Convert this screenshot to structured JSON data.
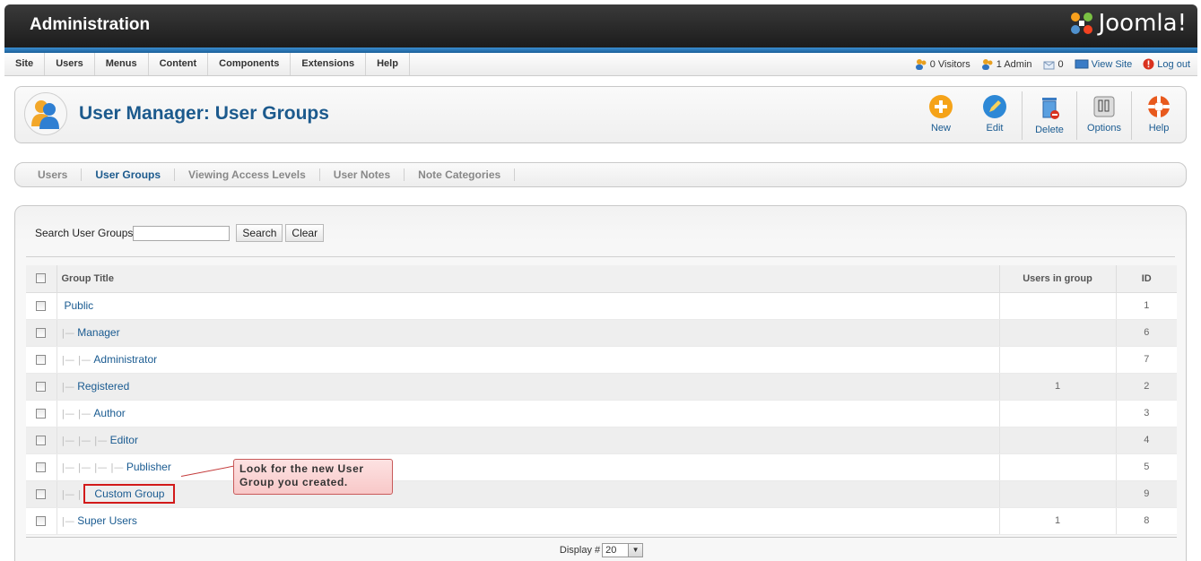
{
  "header": {
    "title": "Administration",
    "logo_text": "Joomla!"
  },
  "menu": [
    "Site",
    "Users",
    "Menus",
    "Content",
    "Components",
    "Extensions",
    "Help"
  ],
  "status": {
    "visitors": "0 Visitors",
    "admins": "1 Admin",
    "messages": "0",
    "view_site": "View Site",
    "logout": "Log out"
  },
  "page": {
    "title": "User Manager: User Groups"
  },
  "toolbar": {
    "new": "New",
    "edit": "Edit",
    "delete": "Delete",
    "options": "Options",
    "help": "Help"
  },
  "submenu": [
    "Users",
    "User Groups",
    "Viewing Access Levels",
    "User Notes",
    "Note Categories"
  ],
  "filter": {
    "label": "Search User Groups",
    "value": "",
    "search_button": "Search",
    "clear_button": "Clear"
  },
  "table": {
    "headers": {
      "title": "Group Title",
      "users": "Users in group",
      "id": "ID"
    },
    "rows": [
      {
        "prefix": "",
        "title": "Public",
        "users": "",
        "id": "1"
      },
      {
        "prefix": "|—",
        "title": "Manager",
        "users": "",
        "id": "6"
      },
      {
        "prefix": "|— |—",
        "title": "Administrator",
        "users": "",
        "id": "7"
      },
      {
        "prefix": "|—",
        "title": "Registered",
        "users": "1",
        "id": "2"
      },
      {
        "prefix": "|— |—",
        "title": "Author",
        "users": "",
        "id": "3"
      },
      {
        "prefix": "|— |— |—",
        "title": "Editor",
        "users": "",
        "id": "4"
      },
      {
        "prefix": "|— |— |— |—",
        "title": "Publisher",
        "users": "",
        "id": "5"
      },
      {
        "prefix": "|— |",
        "title": "Custom Group",
        "users": "",
        "id": "9"
      },
      {
        "prefix": "|—",
        "title": "Super Users",
        "users": "1",
        "id": "8"
      }
    ]
  },
  "pagination": {
    "label": "Display #",
    "limit": "20"
  },
  "callout": {
    "text": "Look for the new User Group you created."
  },
  "colors": {
    "accent": "#1a5b91",
    "highlight": "#d21a1a",
    "callout_bg": "#f8c8c8"
  }
}
